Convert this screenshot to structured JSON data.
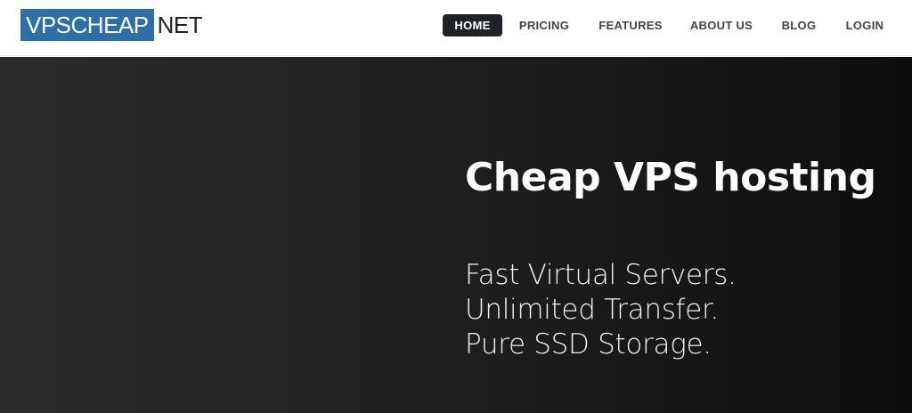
{
  "logo": {
    "primary": "VPSCHEAP",
    "secondary": "NET",
    "primary_bg": "#2e6fa7"
  },
  "nav": {
    "items": [
      {
        "label": "HOME",
        "active": true
      },
      {
        "label": "PRICING",
        "active": false
      },
      {
        "label": "FEATURES",
        "active": false
      },
      {
        "label": "ABOUT US",
        "active": false
      },
      {
        "label": "BLOG",
        "active": false
      },
      {
        "label": "LOGIN",
        "active": false
      }
    ],
    "active_bg": "#1f2226"
  },
  "hero": {
    "title": "Cheap VPS hosting",
    "lines": [
      "Fast Virtual Servers.",
      "Unlimited Transfer.",
      "Pure SSD Storage."
    ]
  }
}
